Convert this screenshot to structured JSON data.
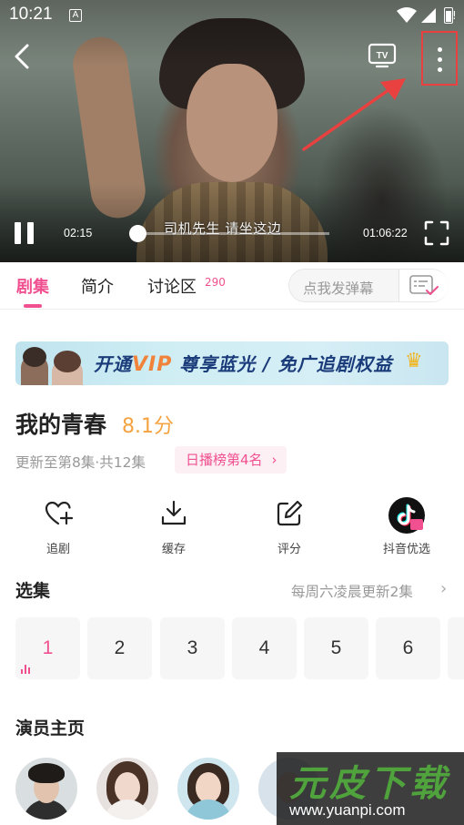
{
  "status_bar": {
    "time": "10:21",
    "notif_icon": "A",
    "battery_extra": "!"
  },
  "player": {
    "current_time": "02:15",
    "total_time": "01:06:22",
    "progress": 0.0339,
    "subtitle": "司机先生 请坐这边",
    "icons": [
      "back-icon",
      "tv-cast-icon",
      "more-vertical-icon",
      "pause-icon",
      "fullscreen-icon"
    ]
  },
  "tabs": {
    "items": [
      {
        "label": "剧集",
        "active": true
      },
      {
        "label": "简介",
        "active": false
      },
      {
        "label": "讨论区",
        "active": false
      }
    ],
    "discussion_count": "290",
    "danmu_placeholder": "点我发弹幕"
  },
  "banner": {
    "prefix": "开通",
    "vip": "VIP",
    "suffix": "尊享蓝光 / 免广追剧权益"
  },
  "show": {
    "title": "我的青春",
    "score": "8.1分",
    "meta": "更新至第8集·共12集",
    "rank": "日播榜第4名"
  },
  "actions": [
    {
      "label": "追剧",
      "icon": "heart-plus-icon"
    },
    {
      "label": "缓存",
      "icon": "download-icon"
    },
    {
      "label": "评分",
      "icon": "edit-icon"
    },
    {
      "label": "抖音优选",
      "icon": "douyin-icon"
    }
  ],
  "episodes": {
    "title": "选集",
    "update_note": "每周六凌晨更新2集",
    "items": [
      "1",
      "2",
      "3",
      "4",
      "5",
      "6"
    ],
    "selected": "1"
  },
  "cast": {
    "title": "演员主页"
  },
  "watermark": {
    "brand": "元皮下载",
    "url": "www.yuanpi.com"
  },
  "colors": {
    "accent": "#f0508f",
    "score": "#f4a340",
    "highlight_box": "#e8413f"
  }
}
